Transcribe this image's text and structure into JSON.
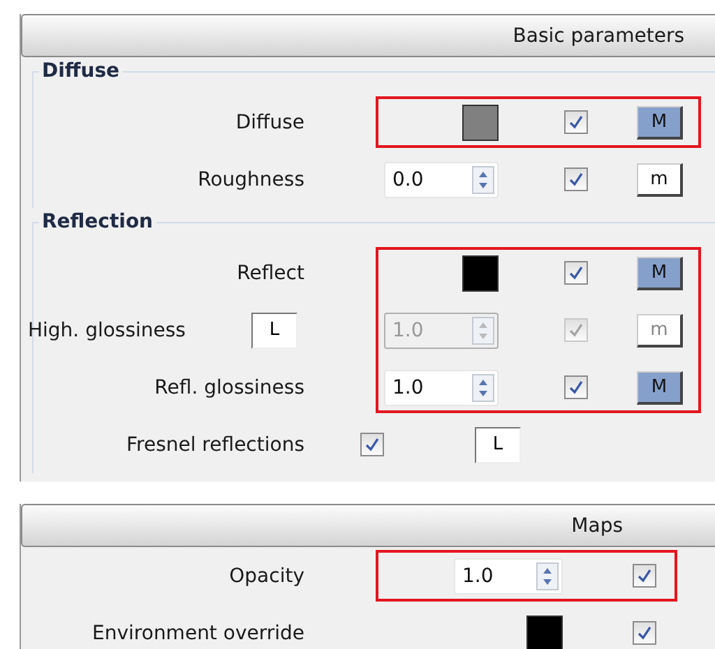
{
  "panels": [
    {
      "kind": "basic",
      "title": "Basic parameters",
      "sections": [
        {
          "title": "Diffuse",
          "groups": [
            {
              "highlighted": true,
              "rows": [
                {
                  "kind": "color",
                  "label": "Diffuse",
                  "color": "#808080",
                  "checked": true,
                  "disabled": false,
                  "map": {
                    "label": "M",
                    "active": true
                  }
                }
              ]
            },
            {
              "highlighted": false,
              "rows": [
                {
                  "kind": "number",
                  "label": "Roughness",
                  "value": "0.0",
                  "checked": true,
                  "disabled": false,
                  "map": {
                    "label": "m",
                    "active": false
                  }
                }
              ]
            }
          ]
        },
        {
          "title": "Reflection",
          "groups": [
            {
              "highlighted": true,
              "rows": [
                {
                  "kind": "color",
                  "label": "Reflect",
                  "color": "#000000",
                  "checked": true,
                  "disabled": false,
                  "map": {
                    "label": "M",
                    "active": true
                  }
                },
                {
                  "kind": "number",
                  "label": "High. glossiness",
                  "lock": "L",
                  "value": "1.0",
                  "checked": true,
                  "disabled": true,
                  "map": {
                    "label": "m",
                    "active": false
                  }
                },
                {
                  "kind": "number",
                  "label": "Refl. glossiness",
                  "value": "1.0",
                  "checked": true,
                  "disabled": false,
                  "map": {
                    "label": "M",
                    "active": true
                  }
                }
              ]
            },
            {
              "highlighted": false,
              "rows": [
                {
                  "kind": "toggle",
                  "label": "Fresnel reflections",
                  "checked": true,
                  "disabled": false,
                  "lock": "L"
                }
              ]
            }
          ]
        }
      ]
    },
    {
      "kind": "maps",
      "title": "Maps",
      "sections": [
        {
          "groups": [
            {
              "highlighted": true,
              "rows": [
                {
                  "kind": "number",
                  "label": "Opacity",
                  "value": "1.0",
                  "checked": true,
                  "disabled": false
                }
              ]
            },
            {
              "highlighted": false,
              "rows": [
                {
                  "kind": "color",
                  "label": "Environment override",
                  "color": "#000000",
                  "checked": true,
                  "disabled": false
                }
              ]
            }
          ]
        }
      ]
    }
  ]
}
